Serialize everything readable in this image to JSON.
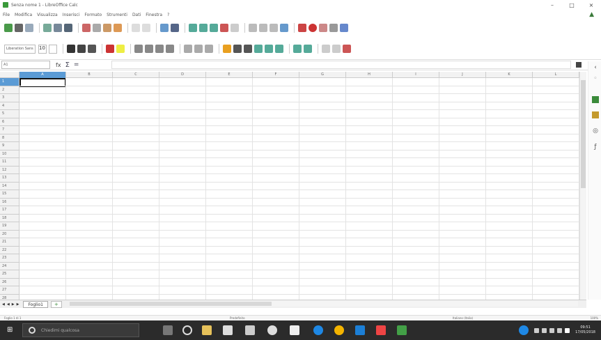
{
  "window": {
    "title": "Senza nome 1 - LibreOffice Calc",
    "controls": [
      "–",
      "□",
      "×"
    ]
  },
  "menu": [
    "File",
    "Modifica",
    "Visualizza",
    "Inserisci",
    "Formato",
    "Strumenti",
    "Dati",
    "Finestra",
    "?"
  ],
  "format_toolbar": {
    "font_name": "Liberation Sans",
    "font_size": "10"
  },
  "formula_bar": {
    "cell_reference": "A1",
    "function_wizard_icon": "fx",
    "sum_icon": "Σ",
    "formula_icon": "=",
    "formula_value": ""
  },
  "grid": {
    "columns": [
      "A",
      "B",
      "C",
      "D",
      "E",
      "F",
      "G",
      "H",
      "I",
      "J",
      "K",
      "L"
    ],
    "rows": [
      "1",
      "2",
      "3",
      "4",
      "5",
      "6",
      "7",
      "8",
      "9",
      "10",
      "11",
      "12",
      "13",
      "14",
      "15",
      "16",
      "17",
      "18",
      "19",
      "20",
      "21",
      "22",
      "23",
      "24",
      "25",
      "26",
      "27",
      "28"
    ],
    "selected_cell": "A1"
  },
  "sheet_tabs": {
    "tabs": [
      "Foglio1"
    ],
    "add_tab": "+"
  },
  "status_bar": {
    "sheet_info": "Foglio 1 di 1",
    "page_style": "Predefinito",
    "language": "Italiano (Italia)",
    "zoom": "100%"
  },
  "taskbar": {
    "search_placeholder": "Chiedimi qualcosa",
    "clock_time": "09:51",
    "clock_date": "17/05/2018"
  }
}
